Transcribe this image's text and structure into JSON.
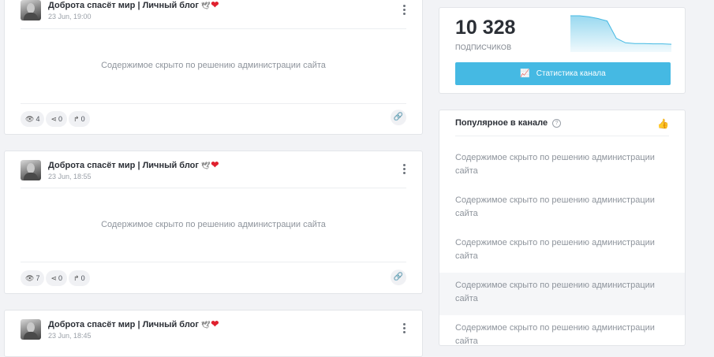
{
  "posts": [
    {
      "author": "Доброта спасёт мир | Личный блог",
      "date": "23 Jun, 19:00",
      "content": "Содержимое скрыто по решению администрации сайта",
      "views": "4",
      "shares": "0",
      "reposts": "0"
    },
    {
      "author": "Доброта спасёт мир | Личный блог",
      "date": "23 Jun, 18:55",
      "content": "Содержимое скрыто по решению администрации сайта",
      "views": "7",
      "shares": "0",
      "reposts": "0"
    },
    {
      "author": "Доброта спасёт мир | Личный блог",
      "date": "23 Jun, 18:45"
    }
  ],
  "channel": {
    "subscribers": "10 328",
    "subscribers_label": "ПОДПИСЧИКОВ",
    "stats_button": "Статистика канала",
    "sparkline": [
      1.0,
      1.0,
      0.97,
      0.92,
      0.85,
      0.35,
      0.22,
      0.2,
      0.2,
      0.19,
      0.19,
      0.18
    ],
    "accent_color": "#45b9e3"
  },
  "popular": {
    "title": "Популярное в канале",
    "items": [
      "Содержимое скрыто по решению администрации сайта",
      "Содержимое скрыто по решению администрации сайта",
      "Содержимое скрыто по решению администрации сайта",
      "Содержимое скрыто по решению администрации сайта",
      "Содержимое скрыто по решению администрации сайта"
    ]
  },
  "icons": {
    "views": "eye-icon",
    "shares": "share-icon",
    "reposts": "repost-icon",
    "link": "link-icon",
    "menu": "kebab-menu-icon",
    "chart": "chart-icon",
    "help": "help-icon",
    "like": "thumbs-up-icon"
  }
}
